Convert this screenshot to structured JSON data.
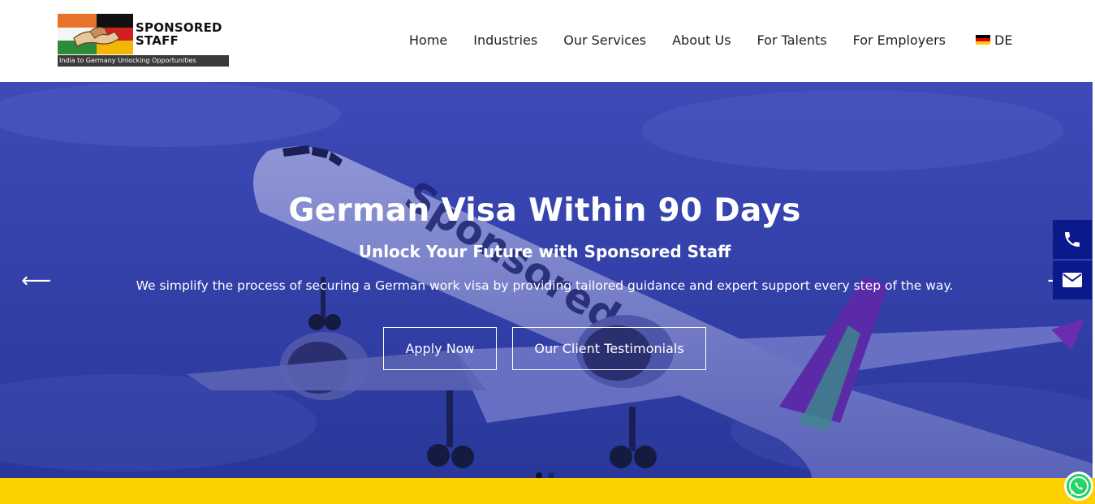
{
  "brand": {
    "name_line1": "SPONSORED",
    "name_line2": "STAFF",
    "tagline": "India to Germany Unlocking Opportunities"
  },
  "nav": {
    "items": [
      {
        "label": "Home"
      },
      {
        "label": "Industries"
      },
      {
        "label": "Our Services"
      },
      {
        "label": "About Us"
      },
      {
        "label": "For Talents"
      },
      {
        "label": "For Employers"
      }
    ],
    "language": {
      "label": "DE",
      "flag_icon": "germany-flag-icon"
    }
  },
  "hero": {
    "title": "German Visa Within 90 Days",
    "subtitle": "Unlock Your Future with Sponsored Staff",
    "description": "We simplify the process of securing a German work visa by providing tailored guidance and expert support every step of the way.",
    "primary_button": "Apply Now",
    "secondary_button": "Our Client Testimonials",
    "prev_arrow": "⟵",
    "next_arrow": "⟶",
    "plane_livery": "Sponsored St",
    "slides_count": 2,
    "active_slide": 1
  },
  "side_contacts": [
    {
      "icon": "phone-icon"
    },
    {
      "icon": "mail-icon"
    }
  ],
  "floating": {
    "icon": "whatsapp-icon"
  },
  "colors": {
    "hero_overlay": "#3340a8",
    "side_button": "#0a1a8a",
    "yellow_bar": "#fdd100",
    "whatsapp": "#25d366"
  }
}
